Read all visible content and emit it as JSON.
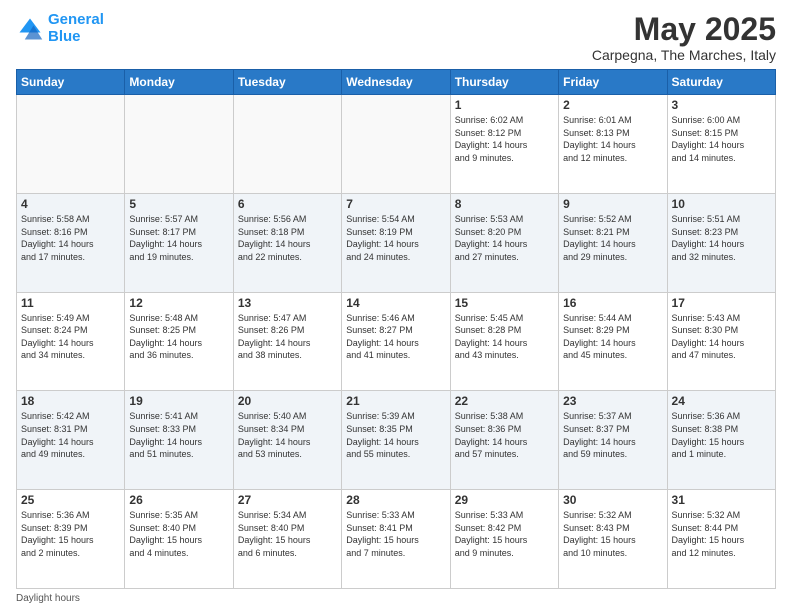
{
  "logo": {
    "line1": "General",
    "line2": "Blue"
  },
  "title": "May 2025",
  "subtitle": "Carpegna, The Marches, Italy",
  "days_header": [
    "Sunday",
    "Monday",
    "Tuesday",
    "Wednesday",
    "Thursday",
    "Friday",
    "Saturday"
  ],
  "weeks": [
    [
      {
        "day": "",
        "info": ""
      },
      {
        "day": "",
        "info": ""
      },
      {
        "day": "",
        "info": ""
      },
      {
        "day": "",
        "info": ""
      },
      {
        "day": "1",
        "info": "Sunrise: 6:02 AM\nSunset: 8:12 PM\nDaylight: 14 hours\nand 9 minutes."
      },
      {
        "day": "2",
        "info": "Sunrise: 6:01 AM\nSunset: 8:13 PM\nDaylight: 14 hours\nand 12 minutes."
      },
      {
        "day": "3",
        "info": "Sunrise: 6:00 AM\nSunset: 8:15 PM\nDaylight: 14 hours\nand 14 minutes."
      }
    ],
    [
      {
        "day": "4",
        "info": "Sunrise: 5:58 AM\nSunset: 8:16 PM\nDaylight: 14 hours\nand 17 minutes."
      },
      {
        "day": "5",
        "info": "Sunrise: 5:57 AM\nSunset: 8:17 PM\nDaylight: 14 hours\nand 19 minutes."
      },
      {
        "day": "6",
        "info": "Sunrise: 5:56 AM\nSunset: 8:18 PM\nDaylight: 14 hours\nand 22 minutes."
      },
      {
        "day": "7",
        "info": "Sunrise: 5:54 AM\nSunset: 8:19 PM\nDaylight: 14 hours\nand 24 minutes."
      },
      {
        "day": "8",
        "info": "Sunrise: 5:53 AM\nSunset: 8:20 PM\nDaylight: 14 hours\nand 27 minutes."
      },
      {
        "day": "9",
        "info": "Sunrise: 5:52 AM\nSunset: 8:21 PM\nDaylight: 14 hours\nand 29 minutes."
      },
      {
        "day": "10",
        "info": "Sunrise: 5:51 AM\nSunset: 8:23 PM\nDaylight: 14 hours\nand 32 minutes."
      }
    ],
    [
      {
        "day": "11",
        "info": "Sunrise: 5:49 AM\nSunset: 8:24 PM\nDaylight: 14 hours\nand 34 minutes."
      },
      {
        "day": "12",
        "info": "Sunrise: 5:48 AM\nSunset: 8:25 PM\nDaylight: 14 hours\nand 36 minutes."
      },
      {
        "day": "13",
        "info": "Sunrise: 5:47 AM\nSunset: 8:26 PM\nDaylight: 14 hours\nand 38 minutes."
      },
      {
        "day": "14",
        "info": "Sunrise: 5:46 AM\nSunset: 8:27 PM\nDaylight: 14 hours\nand 41 minutes."
      },
      {
        "day": "15",
        "info": "Sunrise: 5:45 AM\nSunset: 8:28 PM\nDaylight: 14 hours\nand 43 minutes."
      },
      {
        "day": "16",
        "info": "Sunrise: 5:44 AM\nSunset: 8:29 PM\nDaylight: 14 hours\nand 45 minutes."
      },
      {
        "day": "17",
        "info": "Sunrise: 5:43 AM\nSunset: 8:30 PM\nDaylight: 14 hours\nand 47 minutes."
      }
    ],
    [
      {
        "day": "18",
        "info": "Sunrise: 5:42 AM\nSunset: 8:31 PM\nDaylight: 14 hours\nand 49 minutes."
      },
      {
        "day": "19",
        "info": "Sunrise: 5:41 AM\nSunset: 8:33 PM\nDaylight: 14 hours\nand 51 minutes."
      },
      {
        "day": "20",
        "info": "Sunrise: 5:40 AM\nSunset: 8:34 PM\nDaylight: 14 hours\nand 53 minutes."
      },
      {
        "day": "21",
        "info": "Sunrise: 5:39 AM\nSunset: 8:35 PM\nDaylight: 14 hours\nand 55 minutes."
      },
      {
        "day": "22",
        "info": "Sunrise: 5:38 AM\nSunset: 8:36 PM\nDaylight: 14 hours\nand 57 minutes."
      },
      {
        "day": "23",
        "info": "Sunrise: 5:37 AM\nSunset: 8:37 PM\nDaylight: 14 hours\nand 59 minutes."
      },
      {
        "day": "24",
        "info": "Sunrise: 5:36 AM\nSunset: 8:38 PM\nDaylight: 15 hours\nand 1 minute."
      }
    ],
    [
      {
        "day": "25",
        "info": "Sunrise: 5:36 AM\nSunset: 8:39 PM\nDaylight: 15 hours\nand 2 minutes."
      },
      {
        "day": "26",
        "info": "Sunrise: 5:35 AM\nSunset: 8:40 PM\nDaylight: 15 hours\nand 4 minutes."
      },
      {
        "day": "27",
        "info": "Sunrise: 5:34 AM\nSunset: 8:40 PM\nDaylight: 15 hours\nand 6 minutes."
      },
      {
        "day": "28",
        "info": "Sunrise: 5:33 AM\nSunset: 8:41 PM\nDaylight: 15 hours\nand 7 minutes."
      },
      {
        "day": "29",
        "info": "Sunrise: 5:33 AM\nSunset: 8:42 PM\nDaylight: 15 hours\nand 9 minutes."
      },
      {
        "day": "30",
        "info": "Sunrise: 5:32 AM\nSunset: 8:43 PM\nDaylight: 15 hours\nand 10 minutes."
      },
      {
        "day": "31",
        "info": "Sunrise: 5:32 AM\nSunset: 8:44 PM\nDaylight: 15 hours\nand 12 minutes."
      }
    ]
  ],
  "footer": "Daylight hours"
}
